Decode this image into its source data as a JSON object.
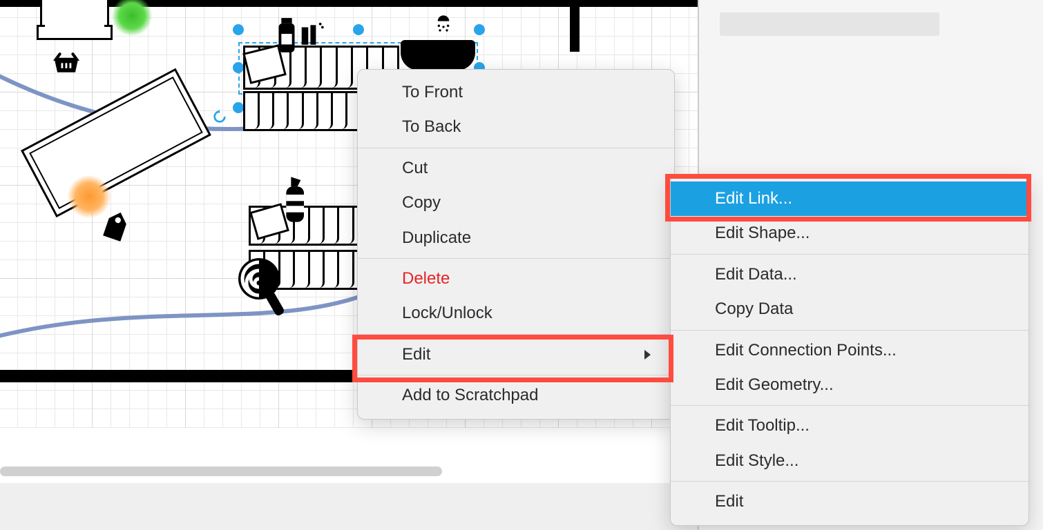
{
  "contextMenu": {
    "items": {
      "toFront": "To Front",
      "toBack": "To Back",
      "cut": "Cut",
      "copy": "Copy",
      "duplicate": "Duplicate",
      "delete": "Delete",
      "lockUnlock": "Lock/Unlock",
      "edit": "Edit",
      "addToScratchpad": "Add to Scratchpad"
    }
  },
  "editSubmenu": {
    "items": {
      "editLink": "Edit Link...",
      "editShape": "Edit Shape...",
      "editData": "Edit Data...",
      "copyData": "Copy Data",
      "editConnectionPoints": "Edit Connection Points...",
      "editGeometry": "Edit Geometry...",
      "editTooltip": "Edit Tooltip...",
      "editStyle": "Edit Style...",
      "edit": "Edit"
    }
  },
  "canvas": {
    "icons": {
      "basket": "basket-icon",
      "shower": "shower-icon",
      "soap": "soap-bottle-icon",
      "tag": "price-tag-icon",
      "spray": "spray-bottle-icon",
      "lollipop": "lollipop-icon"
    }
  }
}
